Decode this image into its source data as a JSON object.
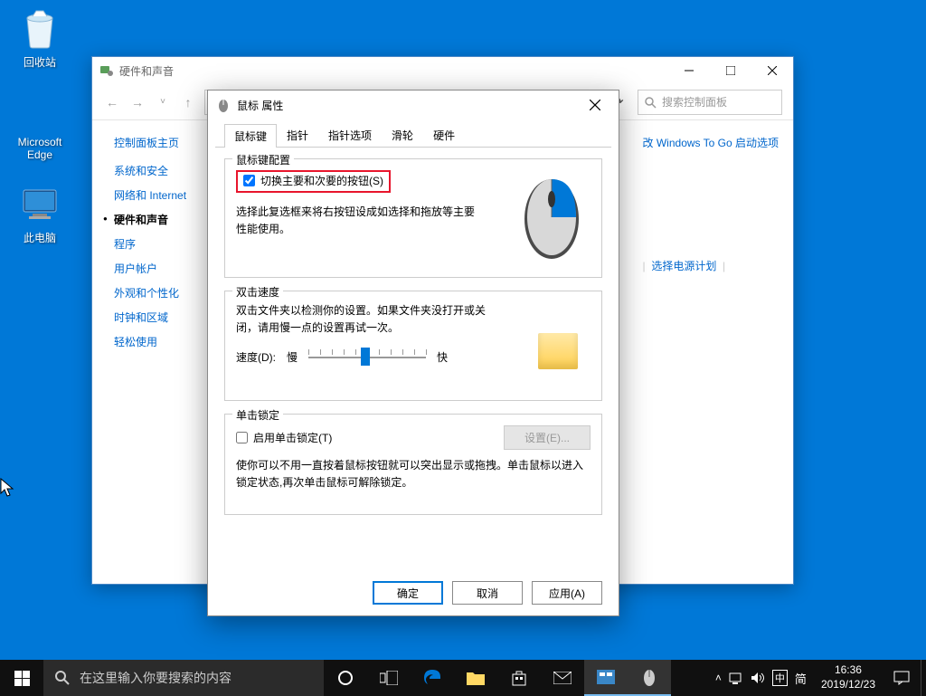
{
  "desktop": {
    "recycle": "回收站",
    "edge": "Microsoft Edge",
    "pc": "此电脑"
  },
  "cp": {
    "title": "硬件和声音",
    "search_placeholder": "搜索控制面板",
    "home": "控制面板主页",
    "side": [
      "系统和安全",
      "网络和 Internet",
      "硬件和声音",
      "程序",
      "用户帐户",
      "外观和个性化",
      "时钟和区域",
      "轻松使用"
    ],
    "right_link1": "改 Windows To Go 启动选项",
    "right_link2": "选择电源计划"
  },
  "dlg": {
    "title": "鼠标 属性",
    "tabs": [
      "鼠标键",
      "指针",
      "指针选项",
      "滑轮",
      "硬件"
    ],
    "group1": {
      "legend": "鼠标键配置",
      "checkbox": "切换主要和次要的按钮(S)",
      "desc": "选择此复选框来将右按钮设成如选择和拖放等主要性能使用。"
    },
    "group2": {
      "legend": "双击速度",
      "desc": "双击文件夹以检测你的设置。如果文件夹没打开或关闭，请用慢一点的设置再试一次。",
      "speed_label": "速度(D):",
      "slow": "慢",
      "fast": "快"
    },
    "group3": {
      "legend": "单击锁定",
      "checkbox": "启用单击锁定(T)",
      "settings_btn": "设置(E)...",
      "desc": "使你可以不用一直按着鼠标按钮就可以突出显示或拖拽。单击鼠标以进入锁定状态,再次单击鼠标可解除锁定。"
    },
    "ok": "确定",
    "cancel": "取消",
    "apply": "应用(A)"
  },
  "taskbar": {
    "search_placeholder": "在这里输入你要搜索的内容",
    "ime1": "中",
    "ime2": "简",
    "time": "16:36",
    "date": "2019/12/23"
  }
}
